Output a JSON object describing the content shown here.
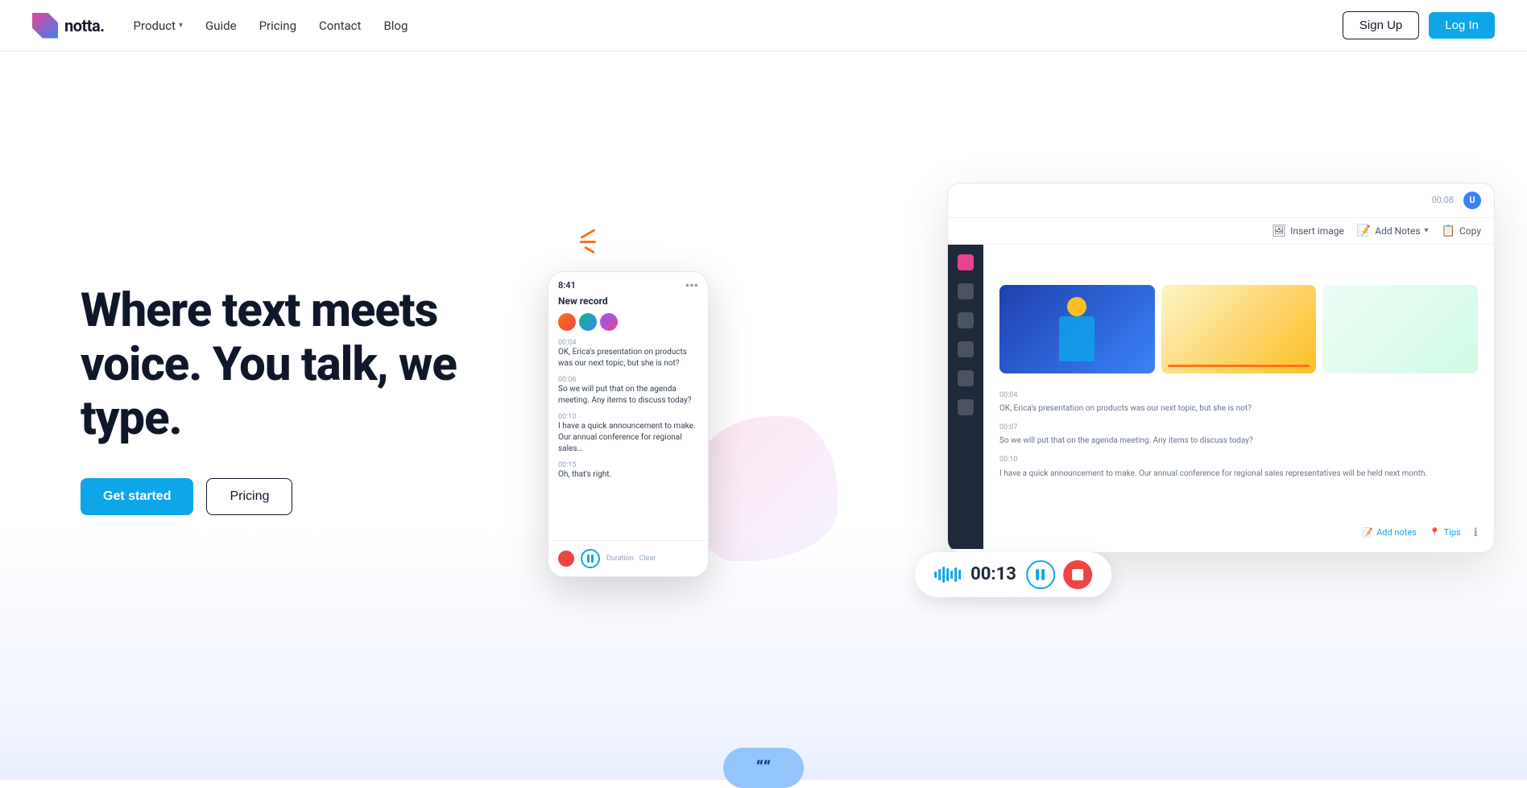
{
  "navbar": {
    "logo_text": "notta.",
    "nav_items": [
      {
        "label": "Product",
        "has_dropdown": true
      },
      {
        "label": "Guide",
        "has_dropdown": false
      },
      {
        "label": "Pricing",
        "has_dropdown": false
      },
      {
        "label": "Contact",
        "has_dropdown": false
      },
      {
        "label": "Blog",
        "has_dropdown": false
      }
    ],
    "signup_label": "Sign Up",
    "login_label": "Log In"
  },
  "hero": {
    "title_line1": "Where text meets",
    "title_line2": "voice. You talk, we",
    "title_line3": "type.",
    "cta_get_started": "Get started",
    "cta_pricing": "Pricing"
  },
  "mockup": {
    "header_time": "00:08",
    "toolbar_insert_image": "Insert image",
    "toolbar_add_notes": "Add Notes",
    "toolbar_copy": "Copy",
    "transcript_time1": "00:04",
    "transcript_text1": "OK, Erica's presentation on products was our next topic, but she is not?",
    "transcript_time2": "00:07",
    "transcript_text2": "So we will put that on the agenda meeting. Any items to discuss today?",
    "transcript_time3": "00:10",
    "transcript_text3": "I have a quick announcement to make. Our annual conference for regional sales representatives will be held next month.",
    "footer_add_notes": "Add notes",
    "footer_tips": "Tips",
    "rec_time": "00:13",
    "mobile_time_label": "8:41",
    "mobile_new_record": "New record",
    "mobile_line1_time": "00:04",
    "mobile_line1_text": "OK, Erica's presentation on products was our next topic, but she is not?",
    "mobile_line2_time": "00:06",
    "mobile_line2_text": "So we will put that on the agenda meeting. Any items to discuss today?",
    "mobile_line3_time": "00:10",
    "mobile_line3_text": "I have a quick announcement to make. Our annual conference for regional sales...",
    "mobile_line4_time": "00:15",
    "mobile_line4_text": "Oh, that's right."
  },
  "bottom": {
    "quote_marks": "““"
  },
  "colors": {
    "brand_blue": "#0ea5e9",
    "brand_pink": "#e84393",
    "dark": "#0f172a",
    "recording_red": "#ef4444"
  }
}
